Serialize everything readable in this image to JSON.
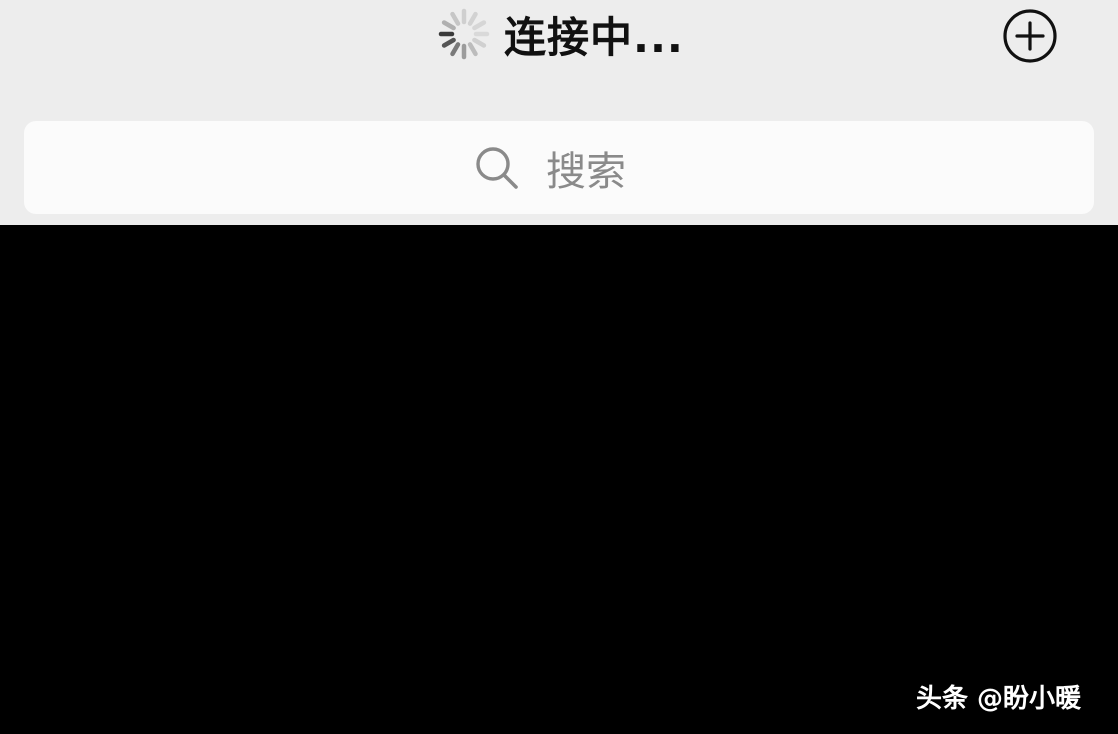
{
  "nav": {
    "title": "连接中...",
    "loading_icon": "spinner-icon",
    "add_icon": "plus-circle-icon"
  },
  "search": {
    "placeholder": "搜索",
    "icon": "search-icon"
  },
  "watermark": {
    "text": "头条 @盼小暖"
  },
  "colors": {
    "header_background": "#ededed",
    "search_background": "#fbfbfb",
    "body_background": "#000000",
    "title_text": "#111111",
    "placeholder_text": "#8a8a8a"
  }
}
